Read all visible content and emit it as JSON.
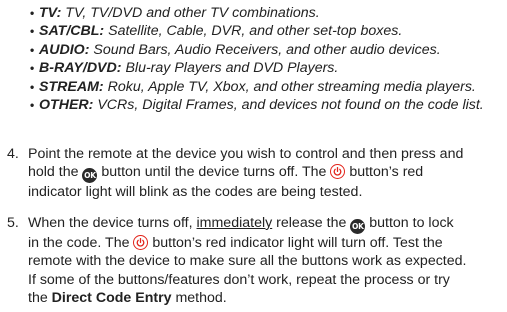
{
  "device_types": [
    {
      "term": "TV:",
      "desc": "TV, TV/DVD and other TV combinations."
    },
    {
      "term": "SAT/CBL:",
      "desc": "Satellite, Cable, DVR, and other set-top boxes."
    },
    {
      "term": "AUDIO:",
      "desc": "Sound Bars, Audio Receivers, and other audio devices."
    },
    {
      "term": "B-RAY/DVD:",
      "desc": "Blu-ray Players and DVD Players."
    },
    {
      "term": "STREAM:",
      "desc": "Roku, Apple TV, Xbox, and other streaming media players."
    },
    {
      "term": "OTHER:",
      "desc": "VCRs, Digital Frames, and devices not found on the code list."
    }
  ],
  "bullet_symbol": "•",
  "icons": {
    "ok_label": "OK",
    "power_color": "#e2231a"
  },
  "step4": {
    "number": "4.",
    "l1": "Point the remote at the device you wish to control and then press and",
    "l2a": "hold the ",
    "l2b": " button until the device turns off. The ",
    "l2c": " button’s red",
    "l3": "indicator light will blink as the codes are being tested."
  },
  "step5": {
    "number": "5.",
    "l1a": "When the device turns off, ",
    "l1b": "immediately",
    "l1c": " release the ",
    "l1d": " button to lock",
    "l2a": "in the code. The ",
    "l2b": " button’s red indicator light will turn off. Test the",
    "l3": "remote with the device to make sure all the buttons work as expected.",
    "l4": "If some of the buttons/features don’t work, repeat the process or try",
    "l5a": "the ",
    "l5b": "Direct Code Entry",
    "l5c": " method."
  }
}
